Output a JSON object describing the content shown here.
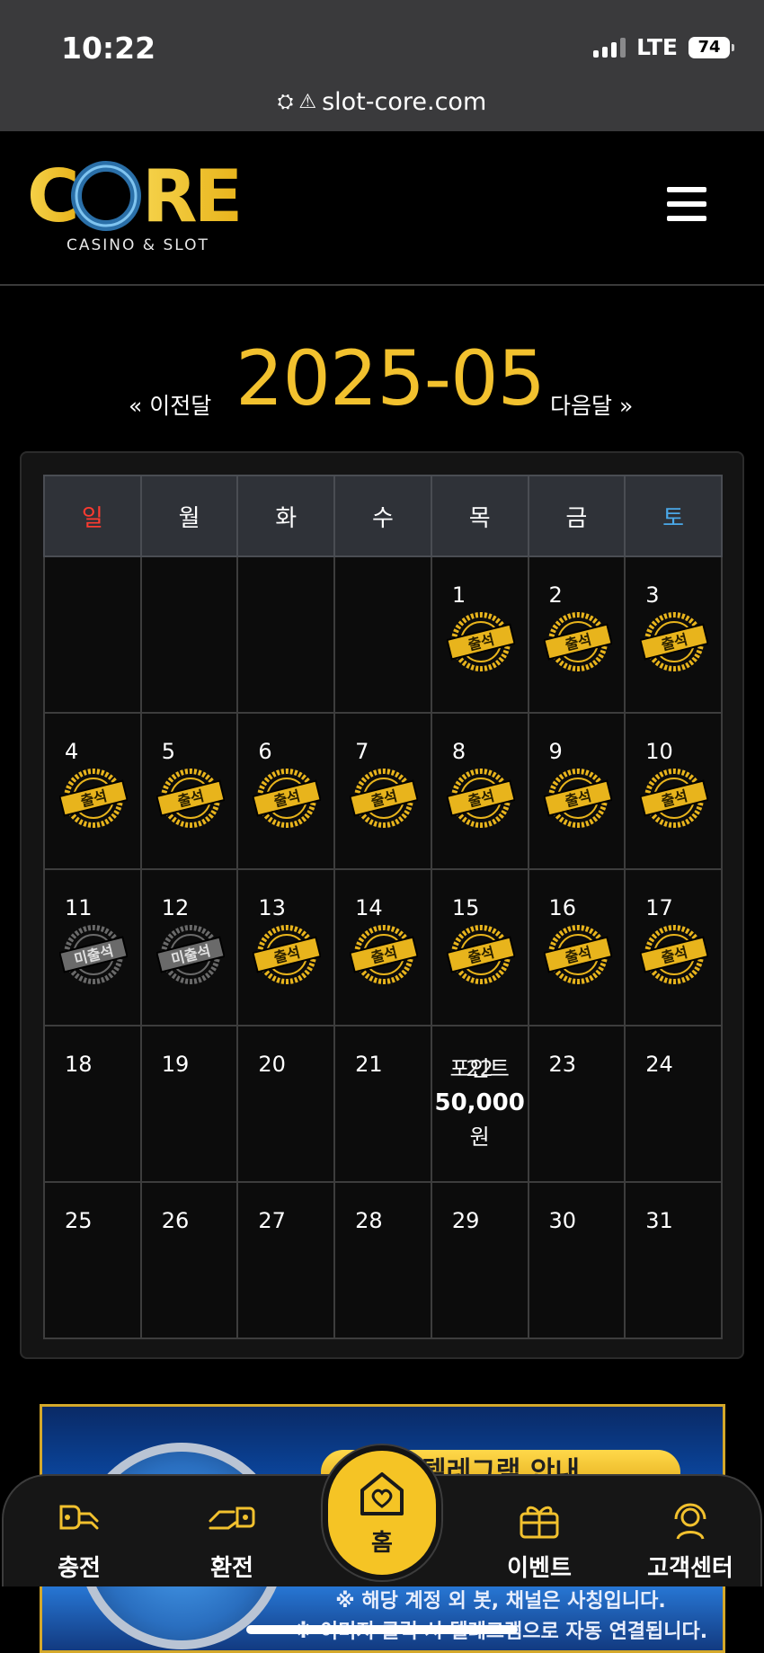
{
  "status_bar": {
    "time": "10:22",
    "network": "LTE",
    "battery": "74"
  },
  "browser": {
    "url": "slot-core.com"
  },
  "header": {
    "logo_text": "CORE",
    "logo_sub": "CASINO & SLOT"
  },
  "month_nav": {
    "prev_label": "« 이전달",
    "title": "2025-05",
    "next_label": "다음달 »"
  },
  "calendar": {
    "weekdays": [
      "일",
      "월",
      "화",
      "수",
      "목",
      "금",
      "토"
    ],
    "weeks": [
      [
        null,
        null,
        null,
        null,
        {
          "day": "1",
          "stamp": "출석"
        },
        {
          "day": "2",
          "stamp": "출석"
        },
        {
          "day": "3",
          "stamp": "출석"
        }
      ],
      [
        {
          "day": "4",
          "stamp": "출석"
        },
        {
          "day": "5",
          "stamp": "출석"
        },
        {
          "day": "6",
          "stamp": "출석"
        },
        {
          "day": "7",
          "stamp": "출석"
        },
        {
          "day": "8",
          "stamp": "출석"
        },
        {
          "day": "9",
          "stamp": "출석"
        },
        {
          "day": "10",
          "stamp": "출석"
        }
      ],
      [
        {
          "day": "11",
          "stamp": "미출석"
        },
        {
          "day": "12",
          "stamp": "미출석"
        },
        {
          "day": "13",
          "stamp": "출석"
        },
        {
          "day": "14",
          "stamp": "출석"
        },
        {
          "day": "15",
          "stamp": "출석"
        },
        {
          "day": "16",
          "stamp": "출석"
        },
        {
          "day": "17",
          "stamp": "출석"
        }
      ],
      [
        {
          "day": "18"
        },
        {
          "day": "19"
        },
        {
          "day": "20"
        },
        {
          "day": "21"
        },
        {
          "day": "22",
          "bonus_label": "포인트",
          "bonus_amount": "50,000",
          "bonus_unit": "원"
        },
        {
          "day": "23"
        },
        {
          "day": "24"
        }
      ],
      [
        {
          "day": "25"
        },
        {
          "day": "26"
        },
        {
          "day": "27"
        },
        {
          "day": "28"
        },
        {
          "day": "29"
        },
        {
          "day": "30"
        },
        {
          "day": "31"
        }
      ]
    ]
  },
  "banner": {
    "title": "텔레그램 안내",
    "line1": "※ 해당 계정 외 봇, 채널은 사칭입니다.",
    "line2": "※ 이미지 클릭 시 텔레그램으로 자동 연결됩니다."
  },
  "bottom_nav": {
    "deposit": "충전",
    "withdraw": "환전",
    "home": "홈",
    "event": "이벤트",
    "support": "고객센터"
  },
  "colors": {
    "accent": "#f2c12e",
    "sunday": "#ff3b30",
    "saturday": "#4aa8e8"
  }
}
